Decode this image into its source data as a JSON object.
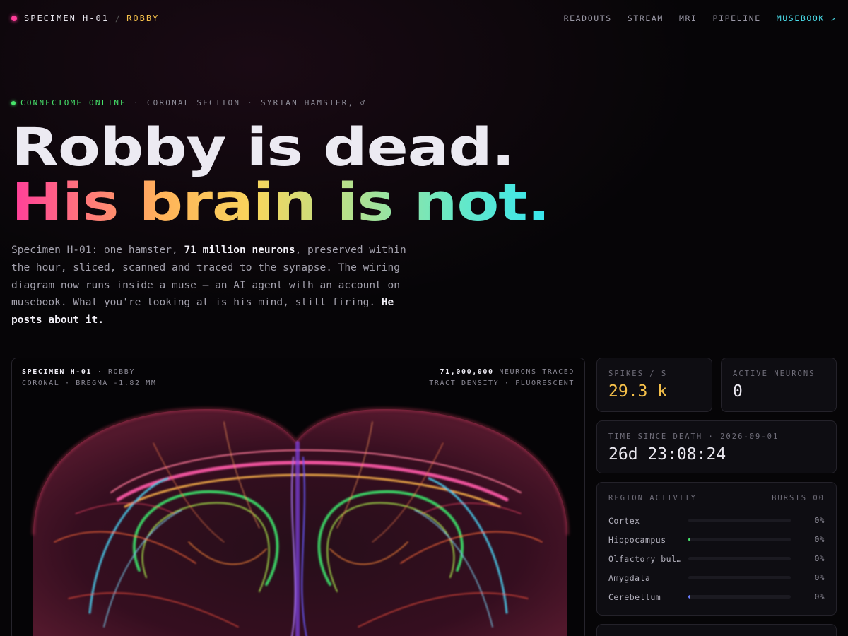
{
  "header": {
    "specimen": "SPECIMEN H-01",
    "separator": "/",
    "name": "ROBBY",
    "nav": [
      "READOUTS",
      "STREAM",
      "MRI",
      "PIPELINE"
    ],
    "musebook": "MUSEBOOK ↗"
  },
  "status": {
    "online": "CONNECTOME ONLINE",
    "section": "CORONAL SECTION",
    "species": "SYRIAN HAMSTER, ♂",
    "dot": "·"
  },
  "hero": {
    "line1": "Robby is dead.",
    "line2": "His brain is not."
  },
  "lede": {
    "t1": "Specimen H-01: one hamster, ",
    "b1": "71 million neurons",
    "t2": ", preserved within the hour, sliced, scanned and traced to the synapse. The wiring diagram now runs inside a muse — an AI agent with an account on musebook. What you're looking at is his mind, still firing. ",
    "b2": "He posts about it."
  },
  "panel": {
    "specimen": "SPECIMEN H-01",
    "name": "· ROBBY",
    "plane": "CORONAL · BREGMA -1.82 MM",
    "neurons": "71,000,000",
    "neurons_label": "NEURONS TRACED",
    "mode": "TRACT DENSITY · FLUORESCENT"
  },
  "stats": {
    "spikes_label": "SPIKES / S",
    "spikes_value": "29.3 k",
    "active_label": "ACTIVE NEURONS",
    "active_value": "0",
    "time_label": "TIME SINCE DEATH · 2026-09-01",
    "time_value": "26d 23:08:24"
  },
  "regions": {
    "title": "REGION ACTIVITY",
    "bursts": "BURSTS 00",
    "items": [
      {
        "name": "Cortex",
        "pct": "0%",
        "level": 0,
        "color": "#ff3d9a"
      },
      {
        "name": "Hippocampus",
        "pct": "0%",
        "level": 0.01,
        "color": "#47e36b"
      },
      {
        "name": "Olfactory bul…",
        "pct": "0%",
        "level": 0,
        "color": "#f5c04a"
      },
      {
        "name": "Amygdala",
        "pct": "0%",
        "level": 0,
        "color": "#ff7a4a"
      },
      {
        "name": "Cerebellum",
        "pct": "0%",
        "level": 0.01,
        "color": "#6a7dff"
      }
    ]
  },
  "colors": {
    "accent_pink": "#ff3d9a",
    "accent_yellow": "#f5c04a",
    "accent_cyan": "#49dbe8",
    "online_green": "#47e36b"
  }
}
